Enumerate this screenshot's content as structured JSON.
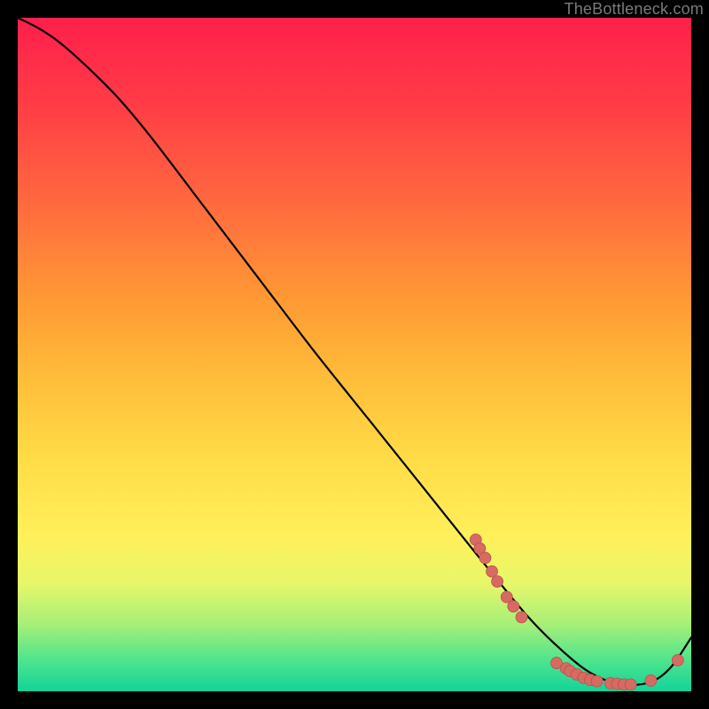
{
  "watermark": {
    "text": "TheBottleneck.com"
  },
  "colors": {
    "line": "#000000",
    "marker_fill": "#d76a62",
    "marker_stroke": "#b6554f"
  },
  "chart_data": {
    "type": "line",
    "title": "",
    "xlabel": "",
    "ylabel": "",
    "xlim": [
      0,
      100
    ],
    "ylim": [
      0,
      100
    ],
    "grid": false,
    "legend": false,
    "series": [
      {
        "name": "curve",
        "x": [
          0,
          3,
          6,
          10,
          15,
          20,
          28,
          36,
          44,
          52,
          60,
          68,
          76,
          82,
          86,
          90,
          94,
          97,
          100
        ],
        "y": [
          100,
          98.5,
          96.5,
          93,
          88,
          82,
          71.5,
          61,
          50.5,
          40.5,
          30.5,
          20.5,
          10.8,
          5.0,
          2.2,
          1.0,
          1.4,
          3.6,
          8.0
        ]
      }
    ],
    "markers": [
      {
        "x": 68.0,
        "y": 22.5
      },
      {
        "x": 68.6,
        "y": 21.2
      },
      {
        "x": 69.4,
        "y": 19.8
      },
      {
        "x": 70.4,
        "y": 17.8
      },
      {
        "x": 71.2,
        "y": 16.3
      },
      {
        "x": 72.6,
        "y": 14.0
      },
      {
        "x": 73.6,
        "y": 12.6
      },
      {
        "x": 74.8,
        "y": 11.0
      },
      {
        "x": 80.0,
        "y": 4.2
      },
      {
        "x": 81.4,
        "y": 3.4
      },
      {
        "x": 82.0,
        "y": 3.0
      },
      {
        "x": 83.0,
        "y": 2.5
      },
      {
        "x": 84.0,
        "y": 2.0
      },
      {
        "x": 85.0,
        "y": 1.7
      },
      {
        "x": 86.0,
        "y": 1.5
      },
      {
        "x": 88.0,
        "y": 1.2
      },
      {
        "x": 89.0,
        "y": 1.1
      },
      {
        "x": 90.0,
        "y": 1.0
      },
      {
        "x": 91.0,
        "y": 1.0
      },
      {
        "x": 94.0,
        "y": 1.6
      },
      {
        "x": 98.0,
        "y": 4.6
      }
    ]
  }
}
